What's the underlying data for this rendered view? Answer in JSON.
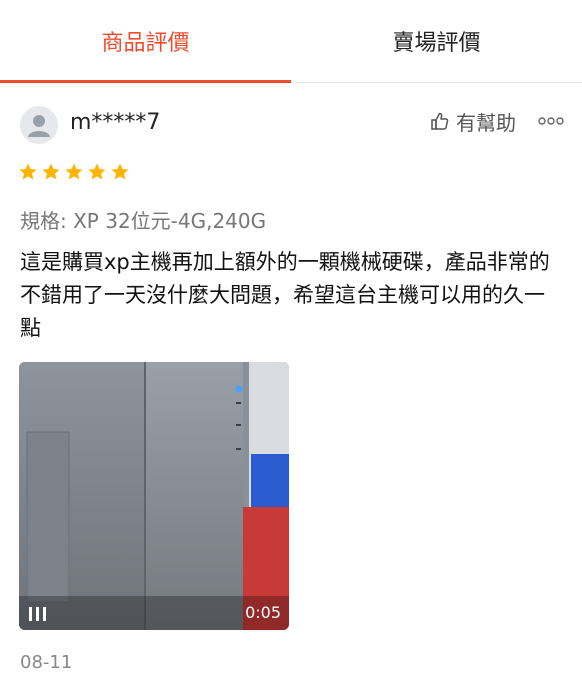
{
  "tabs": [
    {
      "label": "商品評價",
      "active": true
    },
    {
      "label": "賣場評價",
      "active": false
    }
  ],
  "colors": {
    "accent": "#ee4d2d",
    "star": "#ffb400",
    "text": "#222222",
    "muted": "#888888"
  },
  "review": {
    "username": "m*****7",
    "rating": 5,
    "helpful_label": "有幫助",
    "more_icon": "more-dots-icon",
    "spec": "規格: XP 32位元-4G,240G",
    "text": "這是購買xp主機再加上額外的一顆機械硬碟，產品非常的不錯用了一天沒什麼大問題，希望這台主機可以用的久一點",
    "video": {
      "duration": "0:05",
      "icon": "pause-bars-icon"
    },
    "date": "08-11"
  }
}
